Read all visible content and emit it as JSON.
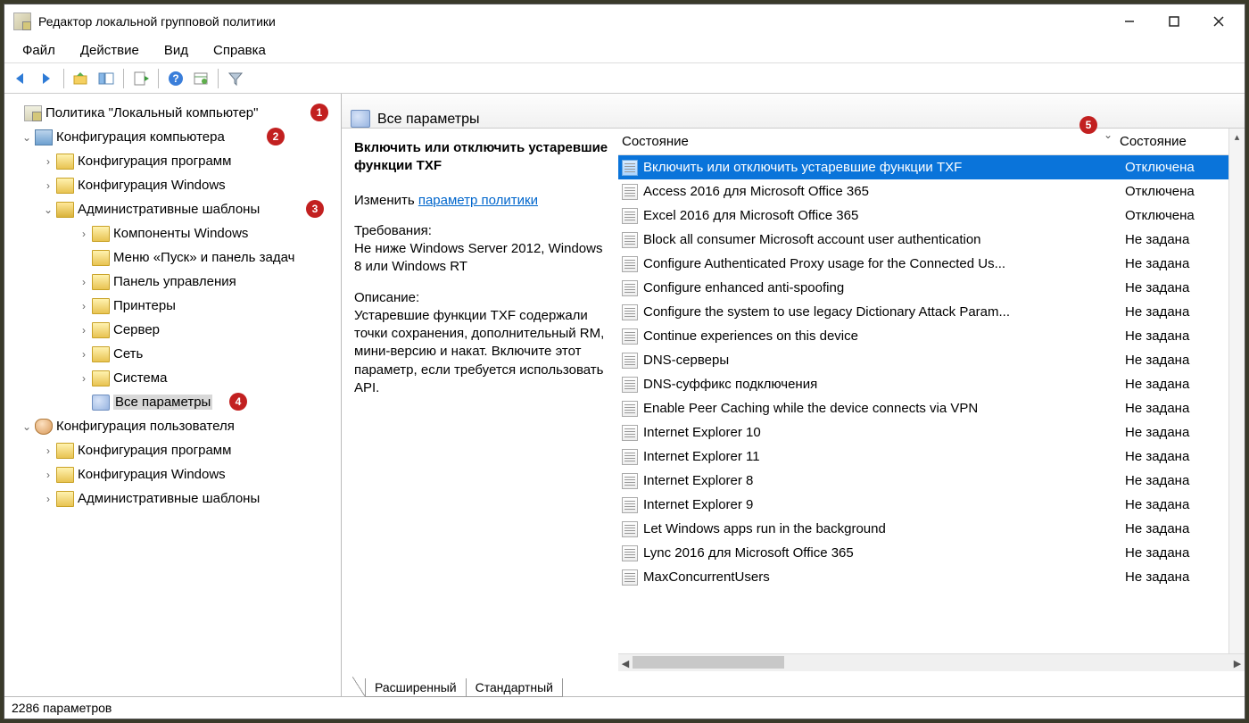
{
  "window": {
    "title": "Редактор локальной групповой политики"
  },
  "menu": {
    "file": "Файл",
    "action": "Действие",
    "view": "Вид",
    "help": "Справка"
  },
  "tree": {
    "root": "Политика \"Локальный компьютер\"",
    "comp_config": "Конфигурация компьютера",
    "soft_config": "Конфигурация программ",
    "win_config": "Конфигурация Windows",
    "admin_templates": "Административные шаблоны",
    "win_components": "Компоненты Windows",
    "start_menu": "Меню «Пуск» и панель задач",
    "control_panel": "Панель управления",
    "printers": "Принтеры",
    "server": "Сервер",
    "network": "Сеть",
    "system": "Система",
    "all_settings": "Все параметры",
    "user_config": "Конфигурация пользователя",
    "u_soft": "Конфигурация программ",
    "u_win": "Конфигурация Windows",
    "u_admin": "Административные шаблоны"
  },
  "badges": {
    "b1": "1",
    "b2": "2",
    "b3": "3",
    "b4": "4",
    "b5": "5"
  },
  "panel": {
    "header": "Все параметры",
    "desc_title": "Включить или отключить устаревшие функции TXF",
    "edit_prefix": "Изменить ",
    "edit_link": "параметр политики",
    "req_label": "Требования:",
    "req_text": "Не ниже Windows Server 2012, Windows 8 или Windows RT",
    "desc_label": "Описание:",
    "desc_text": "Устаревшие функции TXF содержали точки сохранения, дополнительный RM, мини-версию и накат. Включите этот параметр, если требуется использовать API."
  },
  "columns": {
    "c1": "Состояние",
    "c2": "Состояние"
  },
  "rows": [
    {
      "name": "Включить или отключить устаревшие функции TXF",
      "state": "Отключена",
      "sel": true
    },
    {
      "name": "Access 2016 для Microsoft Office 365",
      "state": "Отключена"
    },
    {
      "name": "Excel 2016 для Microsoft Office 365",
      "state": "Отключена"
    },
    {
      "name": "Block all consumer Microsoft account user authentication",
      "state": "Не задана"
    },
    {
      "name": "Configure Authenticated Proxy usage for the Connected Us...",
      "state": "Не задана"
    },
    {
      "name": "Configure enhanced anti-spoofing",
      "state": "Не задана"
    },
    {
      "name": "Configure the system to use legacy Dictionary Attack Param...",
      "state": "Не задана"
    },
    {
      "name": "Continue experiences on this device",
      "state": "Не задана"
    },
    {
      "name": "DNS-серверы",
      "state": "Не задана"
    },
    {
      "name": "DNS-суффикс подключения",
      "state": "Не задана"
    },
    {
      "name": "Enable Peer Caching while the device connects via VPN",
      "state": "Не задана"
    },
    {
      "name": "Internet Explorer 10",
      "state": "Не задана"
    },
    {
      "name": "Internet Explorer 11",
      "state": "Не задана"
    },
    {
      "name": "Internet Explorer 8",
      "state": "Не задана"
    },
    {
      "name": "Internet Explorer 9",
      "state": "Не задана"
    },
    {
      "name": "Let Windows apps run in the background",
      "state": "Не задана"
    },
    {
      "name": "Lync 2016 для Microsoft Office 365",
      "state": "Не задана"
    },
    {
      "name": "MaxConcurrentUsers",
      "state": "Не задана"
    }
  ],
  "tabs": {
    "extended": "Расширенный",
    "standard": "Стандартный"
  },
  "status": "2286 параметров"
}
